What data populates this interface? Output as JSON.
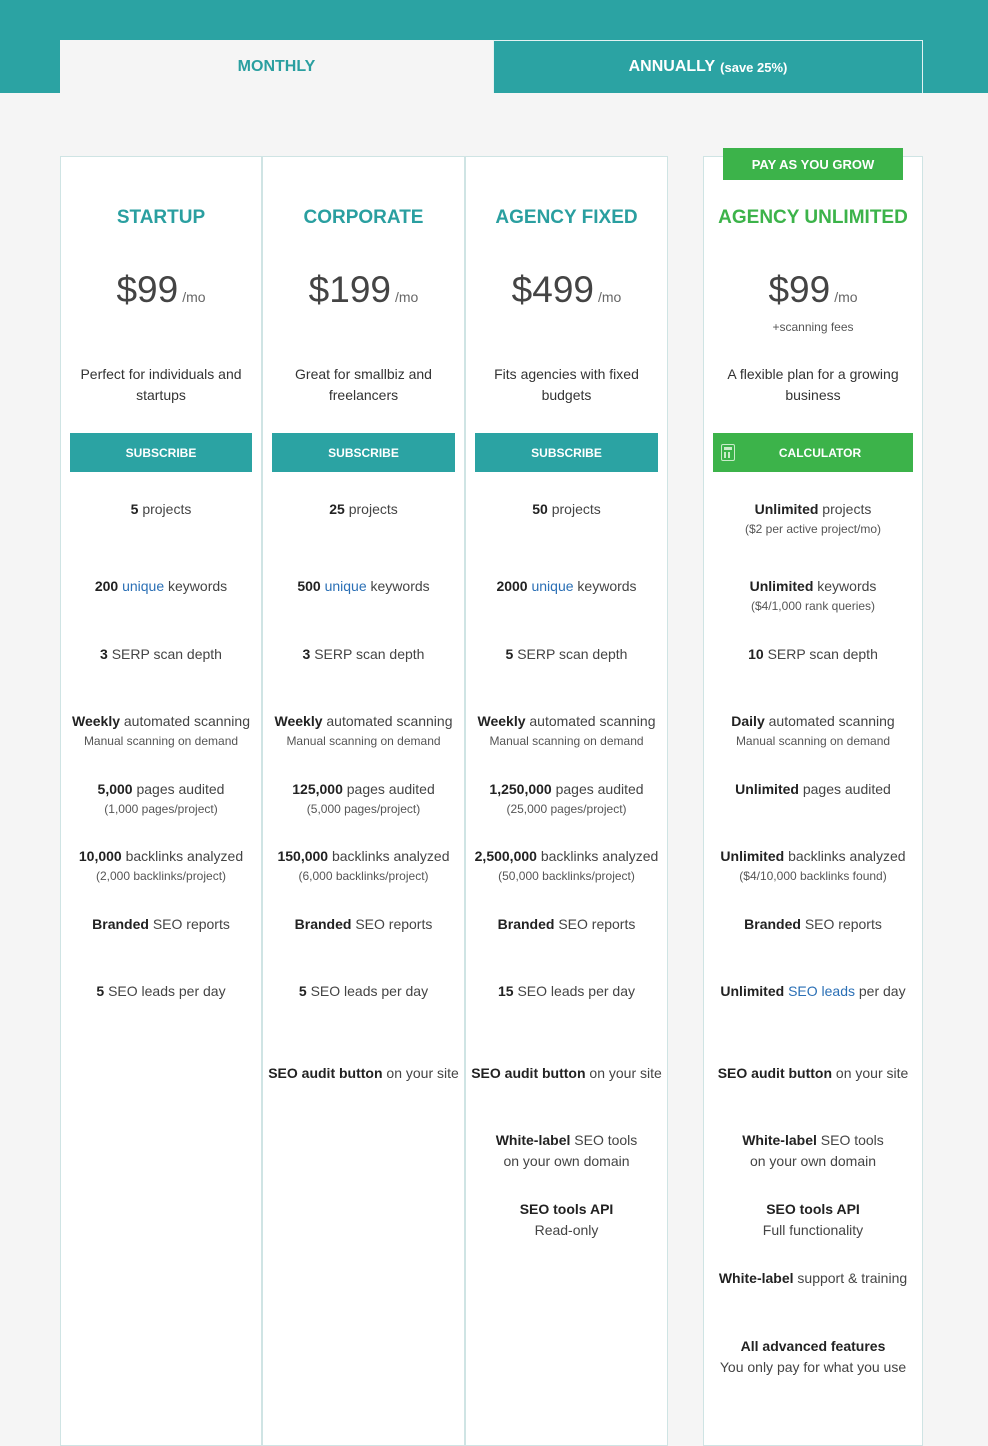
{
  "tabs": {
    "monthly": "MONTHLY",
    "annually": "ANNUALLY",
    "annually_save": "(save 25%)"
  },
  "badge": "PAY AS YOU GROW",
  "currency_unit": "/mo",
  "plans": [
    {
      "name": "STARTUP",
      "price": "$99",
      "desc": "Perfect for individuals and startups",
      "button": "SUBSCRIBE",
      "projects": {
        "b": "5",
        "t": " projects"
      },
      "keywords": {
        "b": "200",
        "link": "unique",
        "t": " keywords"
      },
      "serp": {
        "b": "3",
        "t": " SERP scan depth"
      },
      "scanning": {
        "b": "Weekly",
        "t": " automated scanning",
        "sub": "Manual scanning on demand"
      },
      "pages": {
        "b": "5,000",
        "t": " pages audited",
        "sub": "(1,000 pages/project)"
      },
      "backlinks": {
        "b": "10,000",
        "t": " backlinks analyzed",
        "sub": "(2,000 backlinks/project)"
      },
      "reports": {
        "b": "Branded",
        "t": " SEO reports"
      },
      "leads": {
        "b": "5",
        "t": " SEO leads per day"
      }
    },
    {
      "name": "CORPORATE",
      "price": "$199",
      "desc": "Great for smallbiz and freelancers",
      "button": "SUBSCRIBE",
      "projects": {
        "b": "25",
        "t": " projects"
      },
      "keywords": {
        "b": "500",
        "link": "unique",
        "t": " keywords"
      },
      "serp": {
        "b": "3",
        "t": " SERP scan depth"
      },
      "scanning": {
        "b": "Weekly",
        "t": " automated scanning",
        "sub": "Manual scanning on demand"
      },
      "pages": {
        "b": "125,000",
        "t": " pages audited",
        "sub": "(5,000 pages/project)"
      },
      "backlinks": {
        "b": "150,000",
        "t": " backlinks analyzed",
        "sub": "(6,000 backlinks/project)"
      },
      "reports": {
        "b": "Branded",
        "t": " SEO reports"
      },
      "leads": {
        "b": "5",
        "t": " SEO leads per day"
      },
      "audit": {
        "b": "SEO audit button",
        "t": " on your site"
      }
    },
    {
      "name": "AGENCY FIXED",
      "price": "$499",
      "desc": "Fits agencies with fixed budgets",
      "button": "SUBSCRIBE",
      "projects": {
        "b": "50",
        "t": " projects"
      },
      "keywords": {
        "b": "2000",
        "link": "unique",
        "t": " keywords"
      },
      "serp": {
        "b": "5",
        "t": " SERP scan depth"
      },
      "scanning": {
        "b": "Weekly",
        "t": " automated scanning",
        "sub": "Manual scanning on demand"
      },
      "pages": {
        "b": "1,250,000",
        "t": " pages audited",
        "sub": "(25,000 pages/project)"
      },
      "backlinks": {
        "b": "2,500,000",
        "t": " backlinks analyzed",
        "sub": "(50,000 backlinks/project)"
      },
      "reports": {
        "b": "Branded",
        "t": " SEO reports"
      },
      "leads": {
        "b": "15",
        "t": " SEO leads per day"
      },
      "audit": {
        "b": "SEO audit button",
        "t": " on your site"
      },
      "whitelabel": {
        "b": "White-label",
        "t": " SEO tools",
        "line2": "on your own domain"
      },
      "api": {
        "b": "SEO tools API",
        "line2": "Read-only"
      }
    },
    {
      "name": "AGENCY UNLIMITED",
      "price": "$99",
      "extra": "+scanning fees",
      "desc": "A flexible plan for a growing business",
      "button": "CALCULATOR",
      "projects": {
        "b": "Unlimited",
        "t": " projects",
        "sub": "($2 per active project/mo)"
      },
      "keywords": {
        "b": "Unlimited",
        "t": " keywords",
        "sub": "($4/1,000 rank queries)"
      },
      "serp": {
        "b": "10",
        "t": " SERP scan depth"
      },
      "scanning": {
        "b": "Daily",
        "t": " automated scanning",
        "sub": "Manual scanning on demand"
      },
      "pages": {
        "b": "Unlimited",
        "t": " pages audited"
      },
      "backlinks": {
        "b": "Unlimited",
        "t": " backlinks analyzed",
        "sub": "($4/10,000 backlinks found)"
      },
      "reports": {
        "b": "Branded",
        "t": " SEO reports"
      },
      "leads": {
        "b": "Unlimited",
        "link": "SEO leads",
        "t": " per day"
      },
      "audit": {
        "b": "SEO audit button",
        "t": " on your site"
      },
      "whitelabel": {
        "b": "White-label",
        "t": " SEO tools",
        "line2": "on your own domain"
      },
      "api": {
        "b": "SEO tools API",
        "line2": "Full functionality"
      },
      "support": {
        "b": "White-label",
        "t": " support & training"
      },
      "advanced": {
        "b": "All advanced features",
        "line2": "You only pay for what you use"
      }
    }
  ]
}
